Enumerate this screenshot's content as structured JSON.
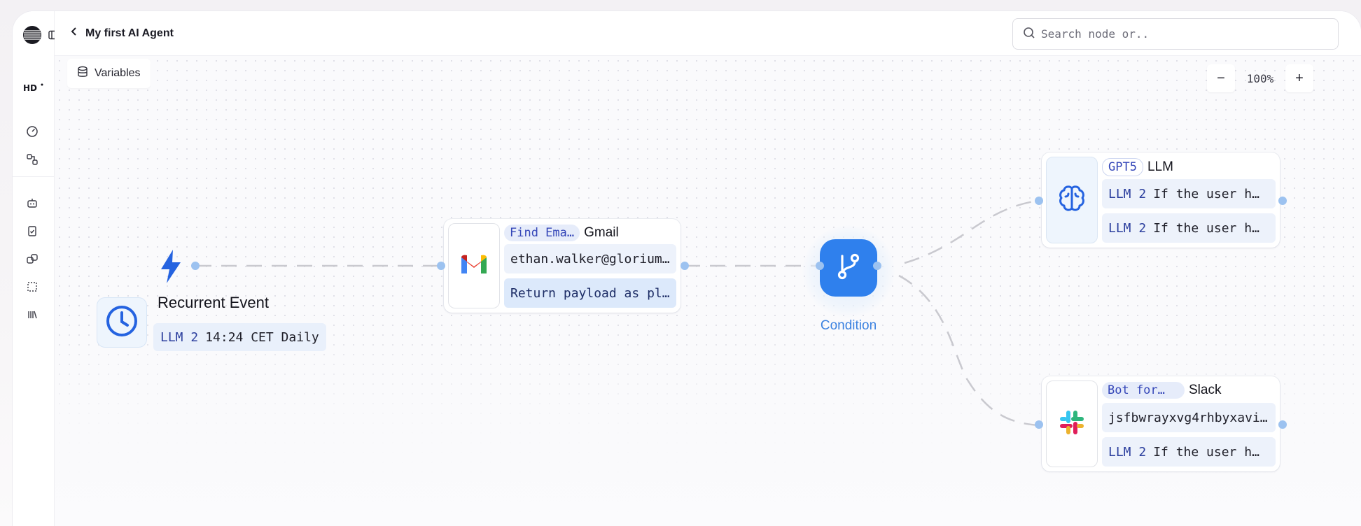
{
  "header": {
    "title": "My first AI Agent",
    "search_placeholder": "Search node or.."
  },
  "toolbar": {
    "variables_label": "Variables",
    "zoom_out": "−",
    "zoom_value": "100%",
    "zoom_in": "+"
  },
  "rail": {
    "icons": [
      "logo-icon",
      "sidebar-toggle-icon",
      "hd-brand",
      "gauge-icon",
      "nodes-icon",
      "bot-icon",
      "clipboard-check-icon",
      "integrations-icon",
      "selection-icon",
      "library-icon"
    ]
  },
  "nodes": {
    "trigger": {
      "title": "Recurrent Event",
      "chip": "LLM 2",
      "value": "14:24 CET Daily"
    },
    "gmail": {
      "tag": "Find Ema…",
      "name": "Gmail",
      "field1": "ethan.walker@glorium…",
      "field2": "Return payload as pl…"
    },
    "condition": {
      "label": "Condition"
    },
    "llm": {
      "tag": "GPT5",
      "name": "LLM",
      "chip1": "LLM 2",
      "field1": "If the user h…",
      "chip2": "LLM 2",
      "field2": "If the user h…"
    },
    "slack": {
      "tag": "Bot for…",
      "name": "Slack",
      "field1": "jsfbwrayxvg4rhbyxavi…",
      "chip2": "LLM 2",
      "field2": "If the user h…"
    }
  },
  "colors": {
    "accent": "#2f80ed",
    "chip_bg": "#e6ecfa",
    "field_bg": "#edf2fb",
    "edge": "#c9c9cf"
  }
}
